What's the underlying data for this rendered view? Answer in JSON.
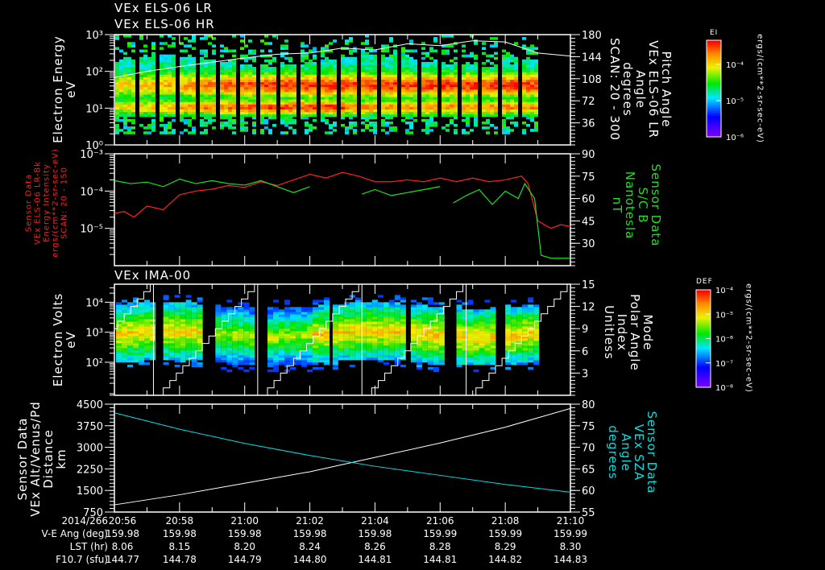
{
  "panel1": {
    "titles": [
      "VEx ELS-06 LR",
      "VEx ELS-06 HR"
    ],
    "ylabel": [
      "Electron Energy",
      "eV"
    ],
    "y2label": [
      "Pitch Angle",
      "VEx ELS-06 LR",
      "Angle",
      "degrees",
      "SCAN: 20 - 300"
    ],
    "colorbar": {
      "title": "EI",
      "ticks": [
        "10⁻⁴",
        "10⁻⁵",
        "10⁻⁶"
      ],
      "unit": "ergs/(cm**2-sr-sec-eV)"
    }
  },
  "panel2": {
    "ylabel": [
      "Sensor Data",
      "VEx ELS-06 LR-Bk",
      "Energy Intensity",
      "ergs/(cm**2-sr-sec-eV)",
      "SCAN: 20 - 150"
    ],
    "y2label": [
      "Sensor Data",
      "S/C B",
      "Nanotesla",
      "nT"
    ]
  },
  "panel3": {
    "title": "VEx IMA-00",
    "ylabel": [
      "Electron Volts",
      "eV"
    ],
    "y2label": [
      "Mode",
      "Polar Angle",
      "Index",
      "Unitless"
    ],
    "colorbar": {
      "title": "DEF",
      "ticks": [
        "10⁻⁴",
        "10⁻⁵",
        "10⁻⁶",
        "10⁻⁷",
        "10⁻⁸"
      ],
      "unit": "ergs/(cm**2-sr-sec-eV)"
    }
  },
  "panel4": {
    "ylabel": [
      "Sensor Data",
      "VEx Alt/Venus/Pd",
      "Distance",
      "km"
    ],
    "y2label": [
      "Sensor Data",
      "VEx SZA",
      "Angle",
      "degrees"
    ]
  },
  "footer": {
    "rows": [
      {
        "label": "2014/266",
        "values": [
          "20:56",
          "20:58",
          "21:00",
          "21:02",
          "21:04",
          "21:06",
          "21:08",
          "21:10"
        ]
      },
      {
        "label": "V-E Ang (deg)",
        "values": [
          "159.98",
          "159.98",
          "159.98",
          "159.98",
          "159.98",
          "159.99",
          "159.99",
          "159.99"
        ]
      },
      {
        "label": "LST (hr)",
        "values": [
          "8.06",
          "8.15",
          "8.20",
          "8.24",
          "8.26",
          "8.28",
          "8.29",
          "8.30"
        ]
      },
      {
        "label": "F10.7 (sfu)",
        "values": [
          "144.77",
          "144.78",
          "144.79",
          "144.80",
          "144.81",
          "144.81",
          "144.82",
          "144.83"
        ]
      }
    ]
  },
  "chart_data": [
    {
      "type": "heatmap",
      "name": "ELS spectrogram",
      "x_range_min": [
        0,
        14
      ],
      "x_origin": "20:56",
      "ylim_log10": [
        0,
        3
      ],
      "yticks": [
        "10⁰",
        "10¹",
        "10²",
        "10³"
      ],
      "y2lim": [
        0,
        180
      ],
      "y2ticks": [
        "36",
        "72",
        "108",
        "144",
        "180"
      ],
      "bands_eV": [
        10,
        40
      ],
      "data_end_min": 12.9,
      "overlay_line_color": "#ffffff",
      "overlay_pitch_angle": [
        [
          0,
          110
        ],
        [
          1,
          120
        ],
        [
          2,
          128
        ],
        [
          3,
          135
        ],
        [
          4,
          142
        ],
        [
          5,
          148
        ],
        [
          6,
          150
        ],
        [
          7,
          158
        ],
        [
          8,
          155
        ],
        [
          9,
          165
        ],
        [
          10,
          162
        ],
        [
          11,
          170
        ],
        [
          12,
          168
        ],
        [
          13,
          150
        ],
        [
          14,
          145
        ]
      ]
    },
    {
      "type": "line",
      "name": "ELS background and magnetic field",
      "ylim_log10": [
        -6,
        -3
      ],
      "yticks": [
        "10⁻⁵",
        "10⁻⁴",
        "10⁻³"
      ],
      "y2lim": [
        15,
        90
      ],
      "y2ticks": [
        "30",
        "45",
        "60",
        "75",
        "90"
      ],
      "series": [
        {
          "name": "ELS LR-Bk",
          "color": "#ff2020",
          "axis": "left",
          "points": [
            [
              0,
              -4.6
            ],
            [
              0.3,
              -4.55
            ],
            [
              0.6,
              -4.7
            ],
            [
              1,
              -4.4
            ],
            [
              1.5,
              -4.5
            ],
            [
              2,
              -4.1
            ],
            [
              2.5,
              -4.0
            ],
            [
              3,
              -3.95
            ],
            [
              3.5,
              -3.85
            ],
            [
              4,
              -3.9
            ],
            [
              4.5,
              -3.75
            ],
            [
              5,
              -3.85
            ],
            [
              5.5,
              -3.7
            ],
            [
              6,
              -3.55
            ],
            [
              6.5,
              -3.65
            ],
            [
              7,
              -3.5
            ],
            [
              7.5,
              -3.6
            ],
            [
              8,
              -3.75
            ],
            [
              8.5,
              -3.75
            ],
            [
              9,
              -3.7
            ],
            [
              9.5,
              -3.75
            ],
            [
              10,
              -3.65
            ],
            [
              10.5,
              -3.75
            ],
            [
              11,
              -3.65
            ],
            [
              11.5,
              -3.75
            ],
            [
              12,
              -3.7
            ],
            [
              12.5,
              -3.6
            ],
            [
              12.7,
              -3.8
            ],
            [
              13,
              -4.8
            ],
            [
              13.4,
              -5.0
            ],
            [
              13.7,
              -4.9
            ],
            [
              14,
              -4.95
            ]
          ]
        },
        {
          "name": "S/C B",
          "color": "#20e020",
          "axis": "right",
          "points": [
            [
              0,
              72
            ],
            [
              0.5,
              70
            ],
            [
              1,
              71
            ],
            [
              1.5,
              68
            ],
            [
              2,
              73
            ],
            [
              2.5,
              70
            ],
            [
              3,
              72
            ],
            [
              3.5,
              70
            ],
            [
              4,
              69
            ],
            [
              4.5,
              72
            ],
            [
              5,
              68
            ],
            [
              5.5,
              64
            ],
            [
              6,
              68
            ],
            [
              null,
              null
            ],
            [
              7.6,
              63
            ],
            [
              8,
              66
            ],
            [
              8.5,
              62
            ],
            [
              9,
              64
            ],
            [
              9.5,
              66
            ],
            [
              10,
              68
            ],
            [
              null,
              null
            ],
            [
              10.4,
              57
            ],
            [
              10.8,
              62
            ],
            [
              11.2,
              66
            ],
            [
              11.6,
              56
            ],
            [
              12,
              65
            ],
            [
              12.4,
              60
            ],
            [
              12.6,
              70
            ],
            [
              12.9,
              60
            ],
            [
              13.1,
              22
            ],
            [
              13.4,
              20
            ],
            [
              14,
              20
            ]
          ]
        }
      ]
    },
    {
      "type": "heatmap",
      "name": "IMA spectrogram",
      "ylim_log10": [
        0.9,
        4.6
      ],
      "yticks": [
        "10²",
        "10³",
        "10⁴"
      ],
      "y2lim": [
        0,
        15
      ],
      "y2ticks": [
        "3",
        "6",
        "9",
        "12",
        "15"
      ],
      "polar_angle_cycle_starts_min": [
        -1.9,
        1.3,
        4.5,
        7.7,
        10.9
      ],
      "cycle_length_min": 3.0
    },
    {
      "type": "line",
      "name": "Altitude and SZA",
      "ylim": [
        750,
        4500
      ],
      "yticks": [
        "750",
        "1500",
        "2250",
        "3000",
        "3750",
        "4500"
      ],
      "y2lim": [
        55,
        80
      ],
      "y2ticks": [
        "55",
        "60",
        "65",
        "70",
        "75",
        "80"
      ],
      "series": [
        {
          "name": "VEx Alt/Venus/Pd",
          "color": "#ffffff",
          "axis": "left",
          "points": [
            [
              0,
              1000
            ],
            [
              2,
              1350
            ],
            [
              4,
              1750
            ],
            [
              6,
              2150
            ],
            [
              8,
              2650
            ],
            [
              10,
              3150
            ],
            [
              12,
              3700
            ],
            [
              14,
              4350
            ]
          ]
        },
        {
          "name": "VEx SZA",
          "color": "#00e0e0",
          "axis": "right",
          "points": [
            [
              0,
              78
            ],
            [
              2,
              74.2
            ],
            [
              4,
              70.9
            ],
            [
              6,
              68.1
            ],
            [
              8,
              65.6
            ],
            [
              10,
              63.5
            ],
            [
              12,
              61.4
            ],
            [
              14,
              59.6
            ]
          ]
        }
      ]
    }
  ]
}
